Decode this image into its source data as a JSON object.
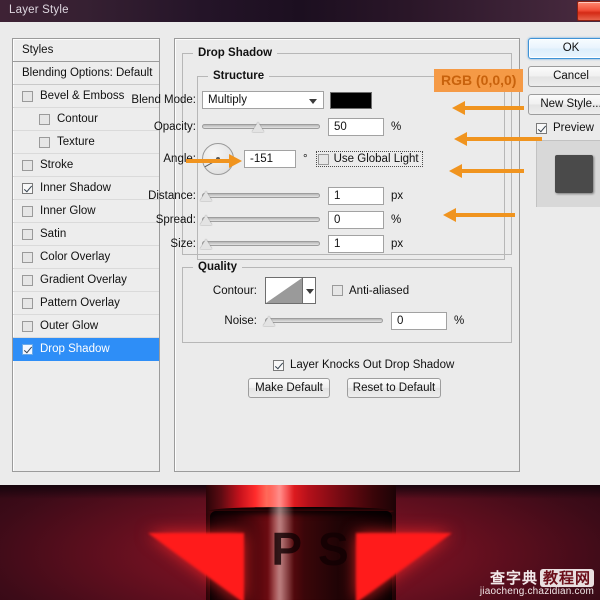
{
  "window": {
    "title": "Layer Style",
    "close_label": "x"
  },
  "styles_panel": {
    "header": "Styles",
    "blending_options": "Blending Options: Default",
    "items": [
      {
        "label": "Bevel & Emboss",
        "checked": false,
        "indent": false,
        "selected": false
      },
      {
        "label": "Contour",
        "checked": false,
        "indent": true,
        "selected": false
      },
      {
        "label": "Texture",
        "checked": false,
        "indent": true,
        "selected": false
      },
      {
        "label": "Stroke",
        "checked": false,
        "indent": false,
        "selected": false
      },
      {
        "label": "Inner Shadow",
        "checked": true,
        "indent": false,
        "selected": false
      },
      {
        "label": "Inner Glow",
        "checked": false,
        "indent": false,
        "selected": false
      },
      {
        "label": "Satin",
        "checked": false,
        "indent": false,
        "selected": false
      },
      {
        "label": "Color Overlay",
        "checked": false,
        "indent": false,
        "selected": false
      },
      {
        "label": "Gradient Overlay",
        "checked": false,
        "indent": false,
        "selected": false
      },
      {
        "label": "Pattern Overlay",
        "checked": false,
        "indent": false,
        "selected": false
      },
      {
        "label": "Outer Glow",
        "checked": false,
        "indent": false,
        "selected": false
      },
      {
        "label": "Drop Shadow",
        "checked": true,
        "indent": false,
        "selected": true
      }
    ]
  },
  "drop_shadow": {
    "group_title": "Drop Shadow",
    "structure_title": "Structure",
    "blend_mode_label": "Blend Mode:",
    "blend_mode_value": "Multiply",
    "shadow_color_hex": "#000000",
    "rgb_badge": "RGB (0,0,0)",
    "opacity_label": "Opacity:",
    "opacity_value": "50",
    "opacity_unit": "%",
    "angle_label": "Angle:",
    "angle_value": "-151",
    "angle_unit": "°",
    "use_global_light_label": "Use Global Light",
    "use_global_light_checked": false,
    "distance_label": "Distance:",
    "distance_value": "1",
    "distance_unit": "px",
    "spread_label": "Spread:",
    "spread_value": "0",
    "spread_unit": "%",
    "size_label": "Size:",
    "size_value": "1",
    "size_unit": "px"
  },
  "quality": {
    "group_title": "Quality",
    "contour_label": "Contour:",
    "anti_aliased_label": "Anti-aliased",
    "anti_aliased_checked": false,
    "noise_label": "Noise:",
    "noise_value": "0",
    "noise_unit": "%",
    "knocks_out_label": "Layer Knocks Out Drop Shadow",
    "knocks_out_checked": true,
    "make_default_label": "Make Default",
    "reset_to_default_label": "Reset to Default"
  },
  "right_buttons": {
    "ok_label": "OK",
    "cancel_label": "Cancel",
    "new_style_label": "New Style...",
    "preview_label": "Preview",
    "preview_checked": true
  },
  "annotations": {
    "accent_color": "#f0941f",
    "badge_bg": "#f59a46",
    "badge_text": "#c8620c",
    "selection_blue": "#2e8ef7"
  },
  "photo": {
    "letters": "P S",
    "watermark_cn_1": "查字典",
    "watermark_cn_2": "教程网",
    "watermark_url": "jiaocheng.chazidian.com"
  }
}
